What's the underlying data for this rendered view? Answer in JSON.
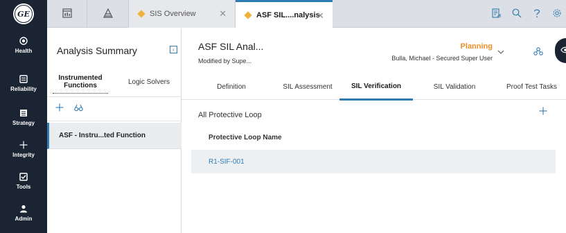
{
  "nav": {
    "logo_text": "GE",
    "items": [
      {
        "label": "Health",
        "icon": "target-icon"
      },
      {
        "label": "Reliability",
        "icon": "doc-icon"
      },
      {
        "label": "Strategy",
        "icon": "list-icon"
      },
      {
        "label": "Integrity",
        "icon": "plus-icon"
      },
      {
        "label": "Tools",
        "icon": "checkbox-icon"
      },
      {
        "label": "Admin",
        "icon": "user-icon"
      }
    ]
  },
  "tabs": {
    "tab1_label": "SIS Overview",
    "tab2_label": "ASF SIL....nalysis"
  },
  "summary": {
    "title": "Analysis Summary",
    "subtab_active": "Instrumented Functions",
    "subtab_inactive": "Logic Solvers",
    "item_label": "ASF - Instru...ted Function"
  },
  "main": {
    "title": "ASF SIL Anal...",
    "subtitle": "Modified by Supe...",
    "state": "Planning",
    "state_user": "Bulla, Michael - Secured Super User",
    "section_tabs": [
      "Definition",
      "SIL Assessment",
      "SIL Verification",
      "SIL Validation",
      "Proof Test Tasks"
    ],
    "active_section": "SIL Verification"
  },
  "panel": {
    "title": "All Protective Loop",
    "column_header": "Protective Loop Name",
    "rows": [
      "R1-SIF-001"
    ]
  },
  "colors": {
    "nav_bg": "#1b2433",
    "accent": "#2f7cb4",
    "state_color": "#e9902a",
    "diamond": "#f0b23c"
  }
}
